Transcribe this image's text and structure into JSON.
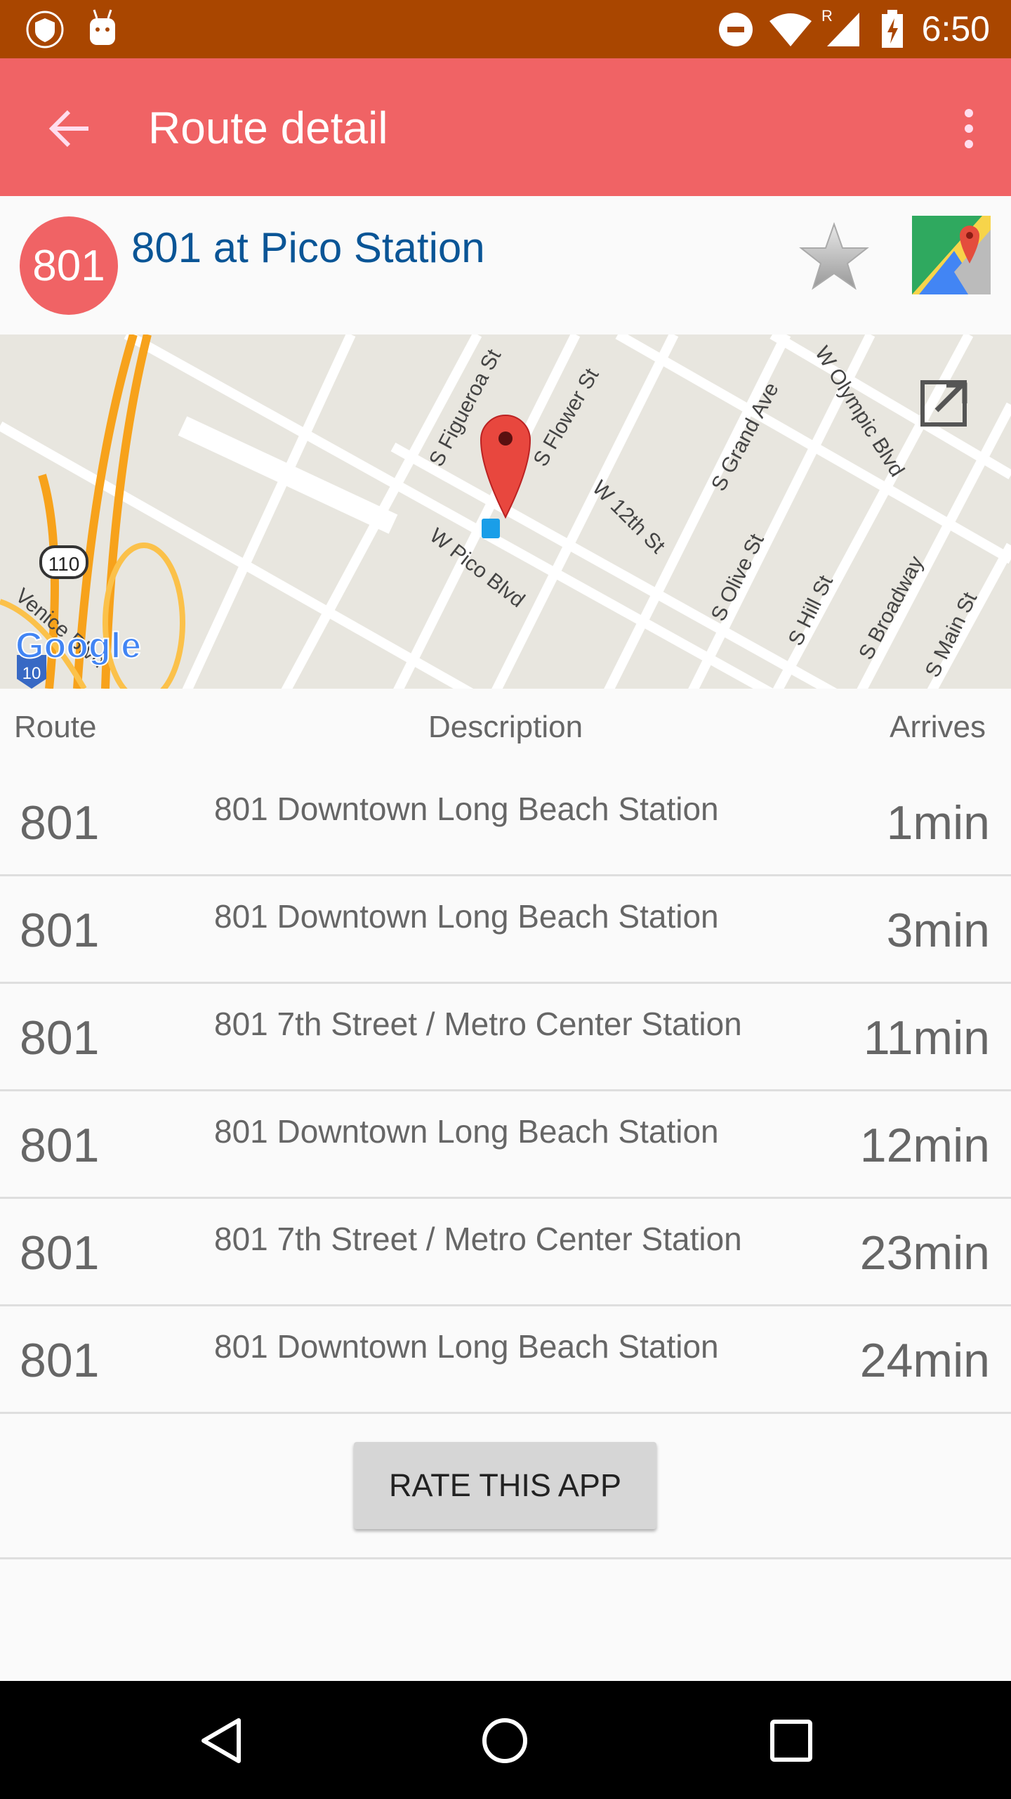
{
  "status_bar": {
    "time": "6:50",
    "icons": [
      "vpn-shield-icon",
      "android-icon",
      "do-not-disturb-icon",
      "wifi-icon",
      "signal-roaming-icon",
      "battery-charging-icon"
    ],
    "roaming_label": "R"
  },
  "app_bar": {
    "title": "Route detail",
    "back_icon": "arrow-left-icon",
    "menu_icon": "more-vert-icon",
    "color": "#f06365"
  },
  "stop": {
    "route_badge": "801",
    "name": "801 at Pico Station",
    "favorite_icon": "star-icon",
    "maps_icon": "google-maps-icon"
  },
  "map": {
    "labels": [
      "S Figueroa St",
      "S Flower St",
      "S Grand Ave",
      "W Olympic Blvd",
      "W 12th St",
      "W Pico Blvd",
      "S Olive St",
      "S Hill St",
      "S Broadway",
      "S Main St",
      "Venice Blvd",
      "110",
      "10"
    ],
    "logo": "Google",
    "open_icon": "open-external-icon"
  },
  "table": {
    "headers": {
      "route": "Route",
      "description": "Description",
      "arrives": "Arrives"
    },
    "rows": [
      {
        "route": "801",
        "description": "801 Downtown Long Beach Station",
        "arrives": "1min"
      },
      {
        "route": "801",
        "description": "801 Downtown Long Beach Station",
        "arrives": "3min"
      },
      {
        "route": "801",
        "description": "801 7th Street / Metro Center Station",
        "arrives": "11min"
      },
      {
        "route": "801",
        "description": "801 Downtown Long Beach Station",
        "arrives": "12min"
      },
      {
        "route": "801",
        "description": "801 7th Street / Metro Center Station",
        "arrives": "23min"
      },
      {
        "route": "801",
        "description": "801 Downtown Long Beach Station",
        "arrives": "24min"
      }
    ]
  },
  "rate_button": "RATE THIS APP"
}
